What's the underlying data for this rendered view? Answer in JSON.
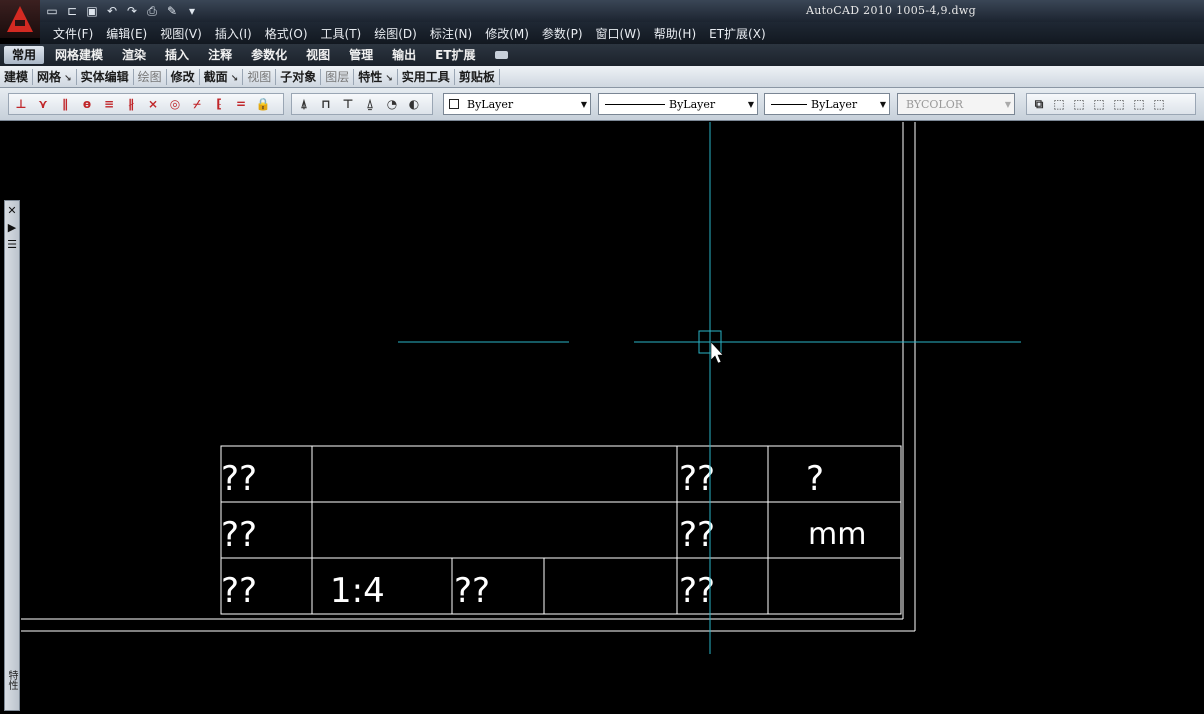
{
  "window": {
    "title": "AutoCAD 2010    1005-4,9.dwg"
  },
  "quick_access": [
    {
      "icon": "new-icon",
      "glyph": "▭"
    },
    {
      "icon": "open-icon",
      "glyph": "⊏"
    },
    {
      "icon": "save-icon",
      "glyph": "▣"
    },
    {
      "icon": "undo-icon",
      "glyph": "↶"
    },
    {
      "icon": "redo-icon",
      "glyph": "↷"
    },
    {
      "icon": "plot-icon",
      "glyph": "⎙"
    },
    {
      "icon": "properties-icon",
      "glyph": "✎"
    },
    {
      "icon": "dropdown-icon",
      "glyph": "▾"
    }
  ],
  "menu": [
    "文件(F)",
    "编辑(E)",
    "视图(V)",
    "插入(I)",
    "格式(O)",
    "工具(T)",
    "绘图(D)",
    "标注(N)",
    "修改(M)",
    "参数(P)",
    "窗口(W)",
    "帮助(H)",
    "ET扩展(X)"
  ],
  "ribbon_tabs": [
    {
      "label": "常用",
      "active": true
    },
    {
      "label": "网格建模",
      "active": false
    },
    {
      "label": "渲染",
      "active": false
    },
    {
      "label": "插入",
      "active": false
    },
    {
      "label": "注释",
      "active": false
    },
    {
      "label": "参数化",
      "active": false
    },
    {
      "label": "视图",
      "active": false
    },
    {
      "label": "管理",
      "active": false
    },
    {
      "label": "输出",
      "active": false
    },
    {
      "label": "ET扩展",
      "active": false
    }
  ],
  "panels": [
    {
      "label": "建模",
      "dim": false,
      "arrow": false
    },
    {
      "label": "网格",
      "dim": false,
      "arrow": true
    },
    {
      "label": "实体编辑",
      "dim": false,
      "arrow": false
    },
    {
      "label": "绘图",
      "dim": true,
      "arrow": false
    },
    {
      "label": "修改",
      "dim": false,
      "arrow": false
    },
    {
      "label": "截面",
      "dim": false,
      "arrow": true
    },
    {
      "label": "视图",
      "dim": true,
      "arrow": false
    },
    {
      "label": "子对象",
      "dim": false,
      "arrow": false
    },
    {
      "label": "图层",
      "dim": true,
      "arrow": false
    },
    {
      "label": "特性",
      "dim": false,
      "arrow": true
    },
    {
      "label": "实用工具",
      "dim": false,
      "arrow": false
    },
    {
      "label": "剪贴板",
      "dim": false,
      "arrow": false
    }
  ],
  "toolbar": {
    "snap_tools": [
      {
        "icon": "snap-endpoint-icon",
        "glyph": "⊥"
      },
      {
        "icon": "snap-perpendicular-icon",
        "glyph": "⋎"
      },
      {
        "icon": "snap-parallel-icon",
        "glyph": "∥"
      },
      {
        "icon": "snap-tangent-icon",
        "glyph": "ɵ"
      },
      {
        "icon": "snap-hatch-icon",
        "glyph": "≡"
      },
      {
        "icon": "snap-construction-icon",
        "glyph": "∦"
      },
      {
        "icon": "snap-intersection-icon",
        "glyph": "⨯"
      },
      {
        "icon": "snap-circle-icon",
        "glyph": "◎"
      },
      {
        "icon": "snap-trim-icon",
        "glyph": "⌿"
      },
      {
        "icon": "snap-bracket-icon",
        "glyph": "⁅"
      },
      {
        "icon": "snap-equal-icon",
        "glyph": "="
      },
      {
        "icon": "lock-icon",
        "glyph": "🔒"
      }
    ],
    "layer_tools": [
      {
        "icon": "layer-walk-icon",
        "glyph": "⍋"
      },
      {
        "icon": "layer-lock-icon",
        "glyph": "⊓"
      },
      {
        "icon": "layer-freeze-icon",
        "glyph": "⊤"
      },
      {
        "icon": "layer-iso-icon",
        "glyph": "⍙"
      },
      {
        "icon": "layer-off-icon",
        "glyph": "◔"
      },
      {
        "icon": "layer-unlock-icon",
        "glyph": "◐"
      }
    ],
    "color_combo": "ByLayer",
    "linetype_combo": "ByLayer",
    "lineweight_combo": "ByLayer",
    "plotstyle_combo": "BYCOLOR",
    "view_tools": [
      {
        "icon": "viewport-icon",
        "glyph": "⧉"
      },
      {
        "icon": "view-front-icon",
        "glyph": "⬚"
      },
      {
        "icon": "view-top-icon",
        "glyph": "⬚"
      },
      {
        "icon": "view-left-icon",
        "glyph": "⬚"
      },
      {
        "icon": "view-right-icon",
        "glyph": "⬚"
      },
      {
        "icon": "view-back-icon",
        "glyph": "⬚"
      },
      {
        "icon": "view-iso-icon",
        "glyph": "⬚"
      }
    ]
  },
  "palette": {
    "close": "✕",
    "autohide": "▶",
    "props": "☰",
    "title": "特性"
  },
  "drawing": {
    "title_block": {
      "row1": [
        "??",
        "",
        "??",
        "?"
      ],
      "row2": [
        "??",
        "",
        "??",
        "mm"
      ],
      "row3": [
        "??",
        "1:4",
        "??",
        "",
        "??",
        ""
      ]
    },
    "colors": {
      "background": "#000000",
      "geometry": "#ffffff",
      "cursor": "#2ab3c6"
    }
  }
}
